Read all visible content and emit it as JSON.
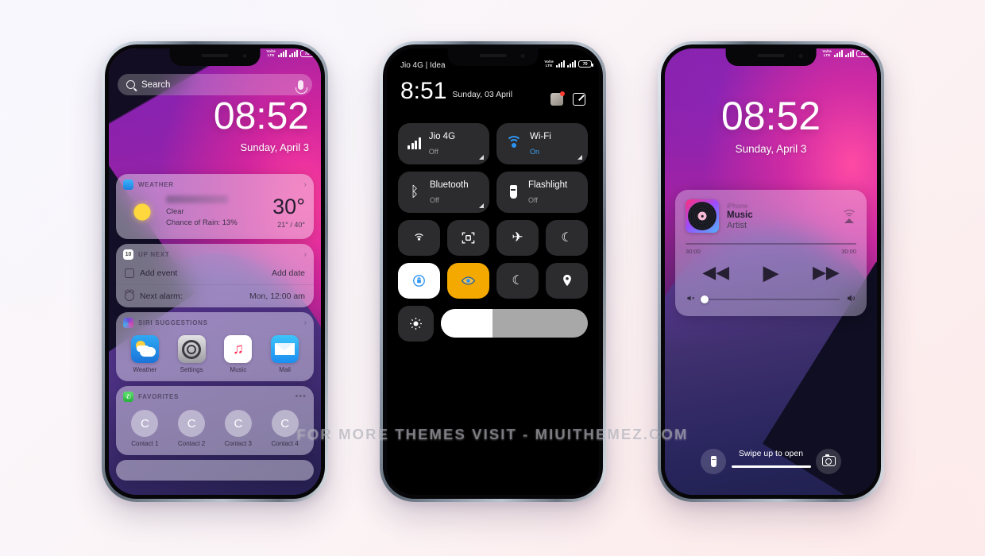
{
  "watermark": "FOR MORE THEMES VISIT - MIUITHEMEZ.COM",
  "colors": {
    "accent_blue": "#2c94f2",
    "accent_amber": "#f4a900",
    "tile_bg": "#2c2c2e",
    "notification_red": "#ff3b30"
  },
  "status_bar": {
    "volte_top": "VoLTE",
    "volte_line1": "Volte",
    "volte_line2": "LTE",
    "battery_percent": "70"
  },
  "phone1": {
    "name": "home-screen-widgets",
    "search": {
      "placeholder": "Search",
      "icon": "search-icon",
      "mic_icon": "microphone-icon"
    },
    "clock": {
      "time": "08:52",
      "date": "Sunday, April 3"
    },
    "weather_card": {
      "header": "WEATHER",
      "icon": "weather-cloud-icon",
      "condition": "Clear",
      "rain": "Chance of Rain: 13%",
      "temp": "30°",
      "range": "21° / 40°",
      "chevron": "›"
    },
    "upnext_card": {
      "header": "UP NEXT",
      "icon": "calendar-icon",
      "chevron": "›",
      "rows": [
        {
          "label": "Add event",
          "value": "Add date",
          "icon": "calendar-add-icon"
        },
        {
          "label": "Next alarm:",
          "value": "Mon, 12:00 am",
          "icon": "alarm-clock-icon"
        }
      ]
    },
    "siri_card": {
      "header": "SIRI SUGGESTIONS",
      "icon": "siri-icon",
      "chevron": "›",
      "apps": [
        {
          "name": "Weather",
          "icon": "weather-app-icon"
        },
        {
          "name": "Settings",
          "icon": "settings-app-icon"
        },
        {
          "name": "Music",
          "icon": "music-app-icon",
          "glyph": "♫"
        },
        {
          "name": "Mail",
          "icon": "mail-app-icon"
        }
      ]
    },
    "favorites_card": {
      "header": "FAVORITES",
      "icon": "phone-icon",
      "more": "•••",
      "contacts": [
        {
          "name": "Contact 1",
          "initial": "C"
        },
        {
          "name": "Contact 2",
          "initial": "C"
        },
        {
          "name": "Contact 3",
          "initial": "C"
        },
        {
          "name": "Contact 4",
          "initial": "C"
        }
      ]
    }
  },
  "phone2": {
    "name": "control-center",
    "carrier": "Jio 4G | Idea",
    "clock": {
      "time": "8:51",
      "date": "Sunday, 03 April"
    },
    "header_icons": [
      {
        "name": "notifications-gift-icon"
      },
      {
        "name": "edit-icon"
      }
    ],
    "tiles": [
      {
        "name": "Jio 4G",
        "state": "Off",
        "state_on": false,
        "icon": "signal-bars-icon"
      },
      {
        "name": "Wi-Fi",
        "state": "On",
        "state_on": true,
        "icon": "wifi-icon"
      },
      {
        "name": "Bluetooth",
        "state": "Off",
        "state_on": false,
        "icon": "bluetooth-icon",
        "glyph": "✱"
      },
      {
        "name": "Flashlight",
        "state": "Off",
        "state_on": false,
        "icon": "flashlight-icon"
      }
    ],
    "toggles": [
      {
        "name": "hotspot-toggle",
        "glyph": "((·))",
        "active": "none"
      },
      {
        "name": "scan-qr-toggle",
        "glyph": "▣",
        "active": "none"
      },
      {
        "name": "airplane-mode-toggle",
        "glyph": "✈",
        "active": "none"
      },
      {
        "name": "dark-mode-toggle",
        "glyph": "☾",
        "active": "none"
      },
      {
        "name": "rotation-lock-toggle",
        "glyph": "🔒",
        "active": "white"
      },
      {
        "name": "reading-mode-toggle",
        "glyph": "◉",
        "active": "amber"
      },
      {
        "name": "night-mode-toggle",
        "glyph": "☾",
        "active": "none"
      },
      {
        "name": "location-toggle",
        "glyph": "◉",
        "active": "none"
      }
    ],
    "brightness": {
      "name": "brightness-slider",
      "icon": "brightness-icon",
      "fill_percent": 35
    }
  },
  "phone3": {
    "name": "lock-screen-music",
    "clock": {
      "time": "08:52",
      "date": "Sunday, April 3"
    },
    "music": {
      "source": "iPhone",
      "title": "Music",
      "artist": "Artist",
      "airplay_icon": "airplay-icon",
      "album_icon": "vinyl-record-icon",
      "elapsed": "30:00",
      "remaining": "30:00",
      "controls": [
        {
          "name": "previous-button",
          "glyph": "◀◀"
        },
        {
          "name": "play-button",
          "glyph": "▶"
        },
        {
          "name": "next-button",
          "glyph": "▶▶"
        }
      ],
      "volume_min_icon": "volume-mute-icon",
      "volume_max_icon": "volume-up-icon",
      "volume_min_glyph": "🔇",
      "volume_max_glyph": "🔊"
    },
    "bottom": {
      "flashlight_icon": "flashlight-icon",
      "camera_icon": "camera-icon",
      "hint": "Swipe up to open"
    }
  }
}
